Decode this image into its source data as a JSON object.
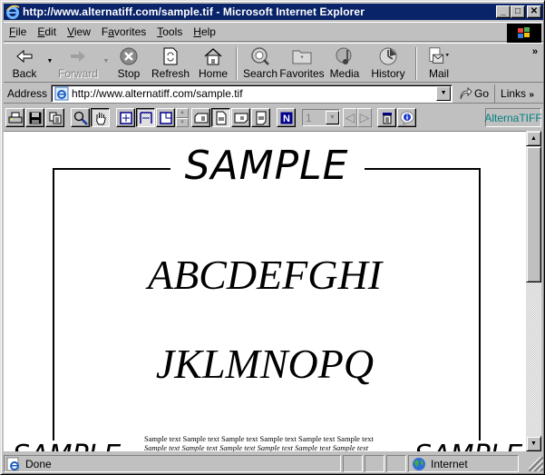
{
  "window": {
    "title": "http://www.alternatiff.com/sample.tif - Microsoft Internet Explorer",
    "controls": {
      "minimize": "_",
      "maximize": "□",
      "close": "✕"
    }
  },
  "menubar": {
    "items": [
      {
        "label": "File",
        "accel": "F",
        "rest": "ile"
      },
      {
        "label": "Edit",
        "accel": "E",
        "rest": "dit"
      },
      {
        "label": "View",
        "accel": "V",
        "rest": "iew"
      },
      {
        "label": "Favorites",
        "pre": "F",
        "accel": "a",
        "rest": "vorites"
      },
      {
        "label": "Tools",
        "accel": "T",
        "rest": "ools"
      },
      {
        "label": "Help",
        "accel": "H",
        "rest": "elp"
      }
    ]
  },
  "toolbar": {
    "back": "Back",
    "forward": "Forward",
    "stop": "Stop",
    "refresh": "Refresh",
    "home": "Home",
    "search": "Search",
    "favorites": "Favorites",
    "media": "Media",
    "history": "History",
    "mail": "Mail",
    "more": "»"
  },
  "address": {
    "label": "Address",
    "url": "http://www.alternatiff.com/sample.tif",
    "go": "Go",
    "links": "Links",
    "links_more": "»"
  },
  "plugin_toolbar": {
    "page_number": "1",
    "brand": "AlternaTIFF",
    "brand_color": "#008080",
    "buttons": [
      "print",
      "save",
      "copy",
      "zoom",
      "pan",
      "fit-window",
      "fit-width",
      "actual-size",
      "zoom-spinner",
      "rotate-left",
      "page-portrait",
      "rotate-right",
      "page-other",
      "negative",
      "page-select",
      "prev-page",
      "next-page",
      "properties",
      "info"
    ],
    "active": [
      "pan",
      "fit-width",
      "page-portrait"
    ]
  },
  "document": {
    "title": "SAMPLE",
    "line1": "ABCDEFGHI",
    "line2": "JKLMNOPQ",
    "small_regular": "Sample text Sample text Sample text Sample text Sample text Sample text",
    "small_italic": "Sample text Sample text Sample text Sample text Sample text Sample text",
    "cut_left": "SAMPLE",
    "cut_right": "SAMPLE"
  },
  "statusbar": {
    "text": "Done",
    "zone": "Internet"
  },
  "colors": {
    "titlebar": "#0a246a",
    "chrome": "#c0c0c0"
  }
}
